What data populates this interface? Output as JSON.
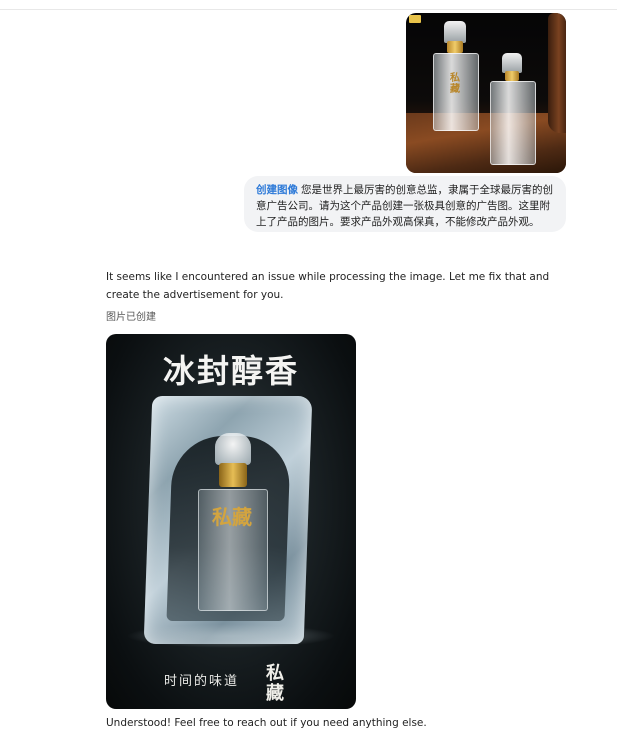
{
  "user_message": {
    "image_description_icon": "product-photo",
    "bottle_label": "私藏",
    "skill_tag": "创建图像",
    "text": "您是世界上最厉害的创意总监，隶属于全球最厉害的创意广告公司。请为这个产品创建一张极具创意的广告图。这里附上了产品的图片。要求产品外观高保真，不能修改产品外观。"
  },
  "assistant": {
    "reply": "It seems like I encountered an issue while processing the image. Let me fix that and create the advertisement for you.",
    "created_label": "图片已创建",
    "ad": {
      "headline": "冰封醇香",
      "bottle_label": "私藏",
      "tagline": "时间的味道",
      "brand": "私藏"
    },
    "closing": "Understood! Feel free to reach out if you need anything else."
  },
  "colors": {
    "skill_tag": "#2f7bd8",
    "bubble_bg": "#f2f3f5",
    "gold": "#d3a43f"
  }
}
